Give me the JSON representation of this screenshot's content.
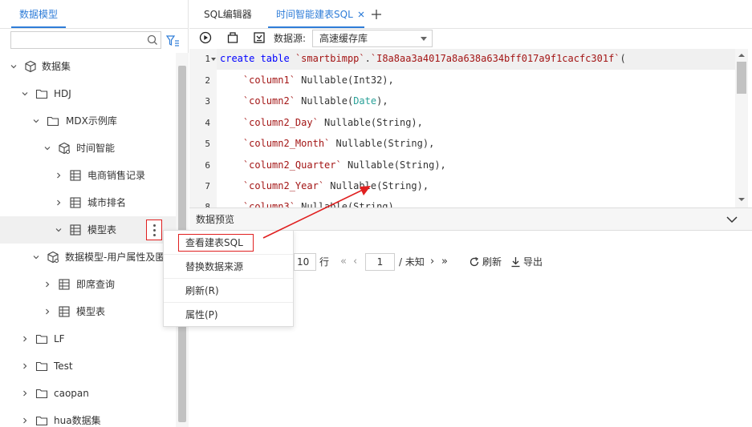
{
  "left_panel": {
    "tab_label": "数据模型",
    "search_placeholder": "",
    "tree": [
      {
        "label": "数据集",
        "icon": "cube-icon",
        "expanded": true
      },
      {
        "label": "HDJ",
        "icon": "folder-icon",
        "expanded": true
      },
      {
        "label": "MDX示例库",
        "icon": "folder-icon",
        "expanded": true
      },
      {
        "label": "时间智能",
        "icon": "data-model-icon",
        "expanded": true
      },
      {
        "label": "电商销售记录",
        "icon": "table-icon",
        "expanded": false
      },
      {
        "label": "城市排名",
        "icon": "table-icon",
        "expanded": false
      },
      {
        "label": "模型表",
        "icon": "table-icon",
        "expanded": true,
        "selected": true
      },
      {
        "label": "数据模型-用户属性及匿",
        "icon": "data-model-icon",
        "expanded": true
      },
      {
        "label": "即席查询",
        "icon": "table-icon",
        "expanded": false
      },
      {
        "label": "模型表",
        "icon": "table-icon",
        "expanded": false
      },
      {
        "label": "LF",
        "icon": "folder-icon",
        "expanded": false
      },
      {
        "label": "Test",
        "icon": "folder-icon",
        "expanded": false
      },
      {
        "label": "caopan",
        "icon": "folder-icon",
        "expanded": false
      },
      {
        "label": "hua数据集",
        "icon": "folder-icon",
        "expanded": false
      }
    ]
  },
  "context_menu": {
    "items": [
      "查看建表SQL",
      "替换数据来源",
      "刷新(R)",
      "属性(P)"
    ]
  },
  "tabs": {
    "tab1": "SQL编辑器",
    "tab2": "时间智能建表SQL"
  },
  "toolbar": {
    "datasource_label": "数据源:",
    "datasource_value": "高速缓存库"
  },
  "editor": {
    "line_numbers": [
      "1",
      "2",
      "3",
      "4",
      "5",
      "6",
      "7",
      "8"
    ]
  },
  "preview": {
    "title": "数据预览",
    "page_size": "10",
    "page_size_unit": "行",
    "page": "1",
    "page_total": "/ 未知",
    "refresh_label": "刷新",
    "export_label": "导出"
  },
  "colors": {
    "accent": "#2f7dd8",
    "highlight": "#e02020",
    "keyword": "#0000ff",
    "string": "#a31515",
    "type_date": "#2aa198"
  }
}
